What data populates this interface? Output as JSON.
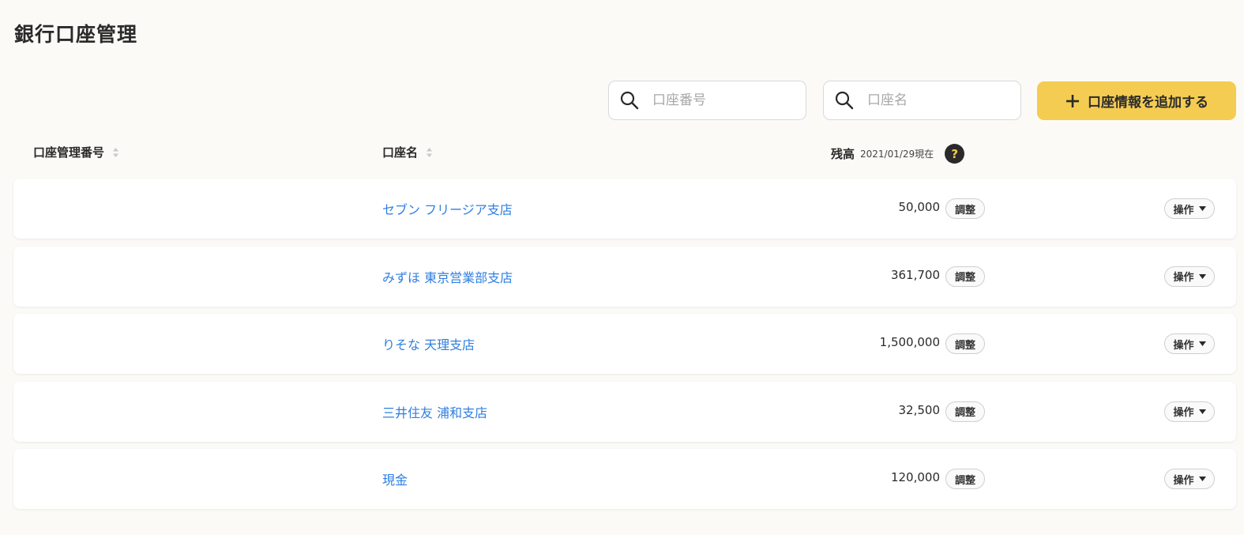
{
  "page": {
    "title": "銀行口座管理"
  },
  "toolbar": {
    "search_number_placeholder": "口座番号",
    "search_name_placeholder": "口座名",
    "add_button_label": "口座情報を追加する"
  },
  "table": {
    "headers": {
      "number": "口座管理番号",
      "name": "口座名",
      "balance": "残高",
      "balance_note": "2021/01/29現在",
      "help": "?"
    },
    "rows": [
      {
        "number": "",
        "name": "セブン フリージア支店",
        "balance": "50,000",
        "adjust_label": "調整",
        "ops_label": "操作"
      },
      {
        "number": "",
        "name": "みずほ 東京営業部支店",
        "balance": "361,700",
        "adjust_label": "調整",
        "ops_label": "操作"
      },
      {
        "number": "",
        "name": "りそな 天理支店",
        "balance": "1,500,000",
        "adjust_label": "調整",
        "ops_label": "操作"
      },
      {
        "number": "",
        "name": "三井住友 浦和支店",
        "balance": "32,500",
        "adjust_label": "調整",
        "ops_label": "操作"
      },
      {
        "number": "",
        "name": "現金",
        "balance": "120,000",
        "adjust_label": "調整",
        "ops_label": "操作"
      }
    ]
  },
  "icons": {
    "search": "search-icon",
    "add": "plus-icon",
    "sort": "sort-icon",
    "help": "question-icon",
    "dropdown": "caret-down-icon"
  },
  "colors": {
    "accent": "#f5cc52",
    "link": "#2f7fe0",
    "background": "#fbfaf7"
  }
}
